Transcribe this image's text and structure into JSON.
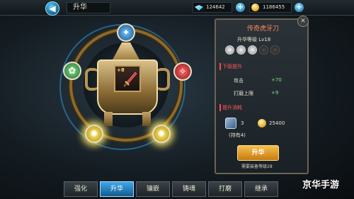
{
  "topbar": {
    "title": "升华",
    "diamonds": "124642",
    "coins": "1186455",
    "back_icon": "back-arrow-icon",
    "plus_icon": "plus-icon"
  },
  "hexagram": {
    "weapon_level": "+8",
    "nodes": [
      "blue-rune",
      "green-rune",
      "red-rune",
      "yellow-rune",
      "yellow-rune"
    ]
  },
  "panel": {
    "weapon_name": "传奇虎牙刀",
    "grade_label": "升华等级",
    "grade_value": "Lv18",
    "next_level_tag": "下级提升",
    "attack_label": "攻击",
    "attack_value": "+70",
    "grind_label": "打磨上限",
    "grind_value": "+9",
    "material_tag": "提升消耗",
    "material_count": "3",
    "material_owned": "(持有4)",
    "coin_cost": "25400",
    "upgrade_button": "升华",
    "requirement": "需要装备等级28"
  },
  "tabs": [
    "强化",
    "升华",
    "镶嵌",
    "铸魂",
    "打磨",
    "继承"
  ],
  "active_tab": "升华",
  "watermark": "京华手游",
  "colors": {
    "accent": "#3fa8ea",
    "gold": "#f6c04a",
    "stat_green": "#7fe37f",
    "tag_red": "#ff5a5a"
  }
}
